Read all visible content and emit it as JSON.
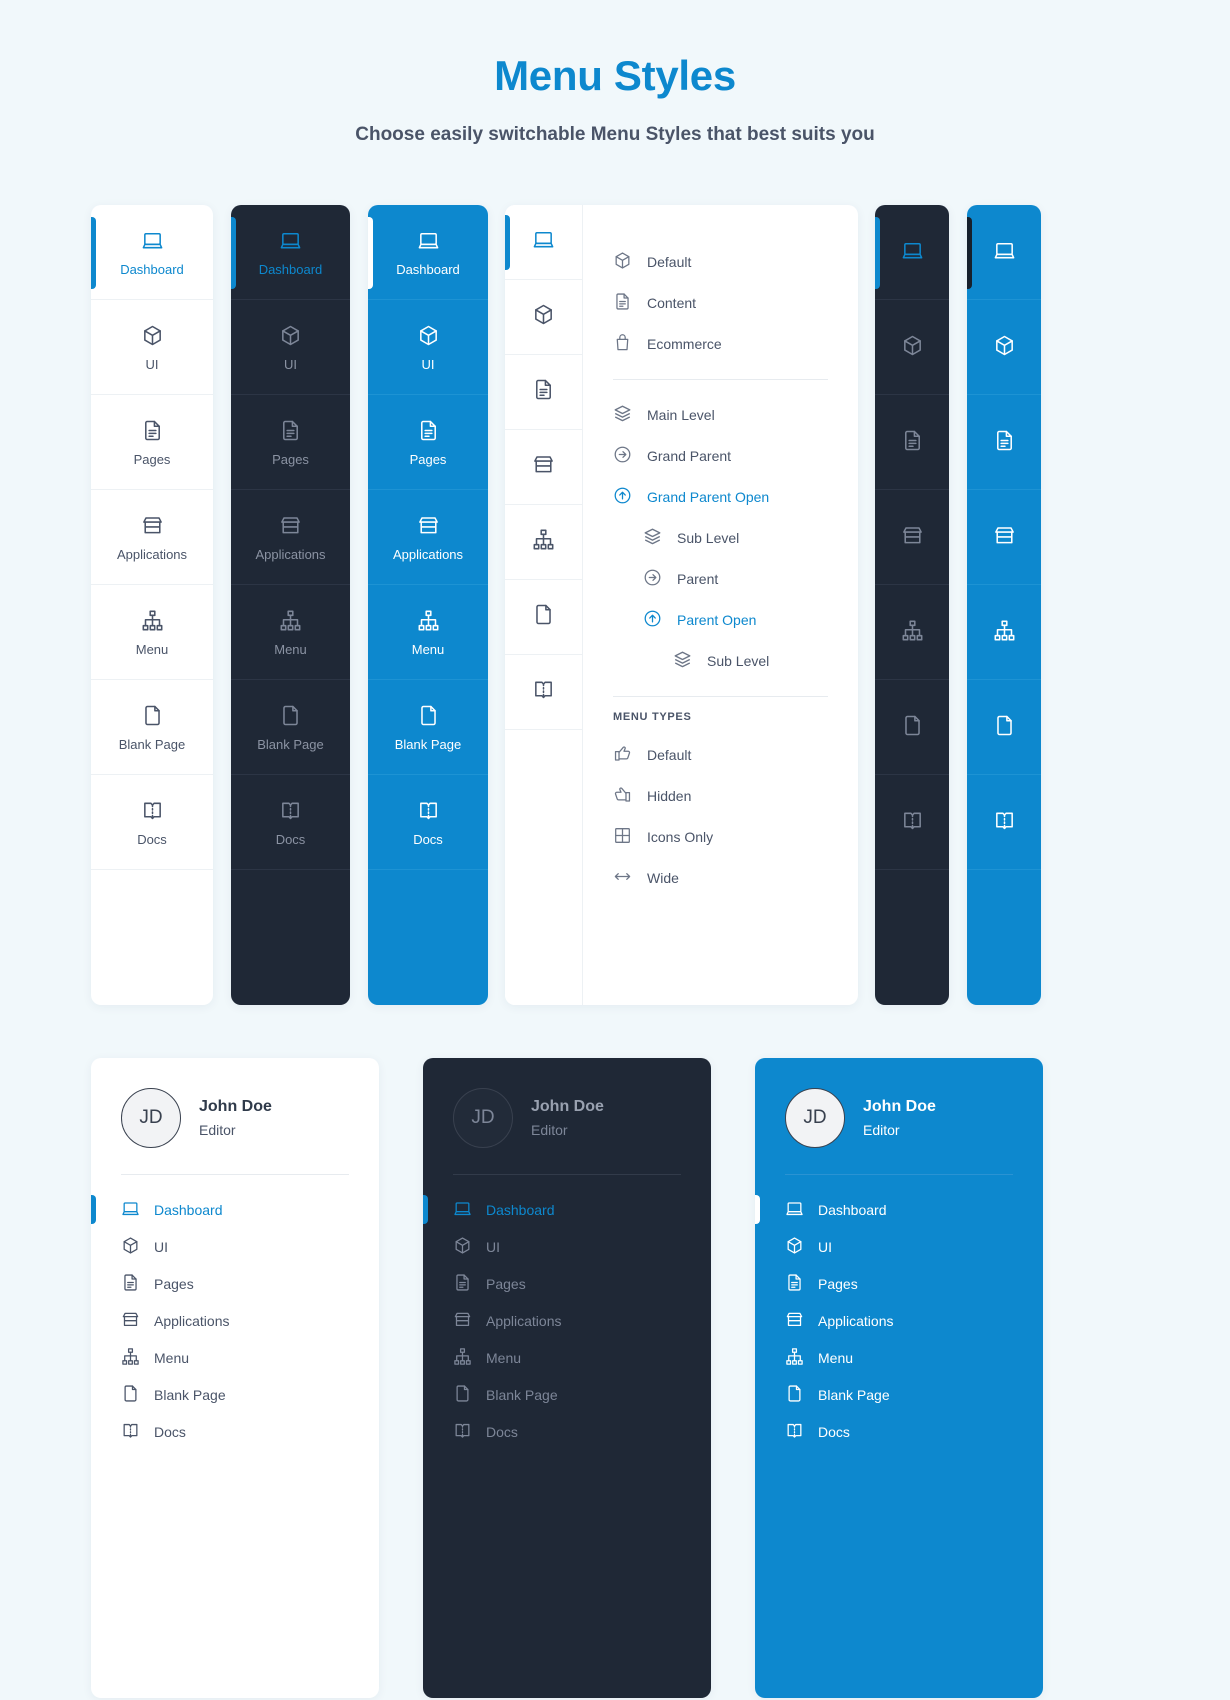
{
  "header": {
    "title": "Menu Styles",
    "subtitle": "Choose easily switchable Menu Styles that best suits you"
  },
  "colors": {
    "accent": "#0d88ce",
    "dark": "#1f2836",
    "page_bg": "#f1f8fb",
    "text": "#4a5468"
  },
  "main_menu": [
    {
      "label": "Dashboard",
      "icon": "laptop-icon"
    },
    {
      "label": "UI",
      "icon": "cube-icon"
    },
    {
      "label": "Pages",
      "icon": "document-lines-icon"
    },
    {
      "label": "Applications",
      "icon": "storefront-icon"
    },
    {
      "label": "Menu",
      "icon": "sitemap-icon"
    },
    {
      "label": "Blank Page",
      "icon": "blank-page-icon"
    },
    {
      "label": "Docs",
      "icon": "book-icon"
    }
  ],
  "panels": [
    {
      "name": "light-vertical-menu",
      "theme": "light",
      "active_index": 0
    },
    {
      "name": "dark-vertical-menu",
      "theme": "dark",
      "active_index": 0
    },
    {
      "name": "blue-vertical-menu",
      "theme": "blue",
      "active_index": 0
    },
    {
      "name": "light-submenu-panel",
      "theme": "light",
      "active_index": 0
    },
    {
      "name": "dark-icons-only-menu",
      "theme": "dark",
      "active_index": 0
    },
    {
      "name": "blue-icons-only-menu",
      "theme": "blue",
      "active_index": 0
    }
  ],
  "submenu": {
    "group_one": [
      {
        "label": "Default",
        "icon": "cube-icon",
        "level": 0,
        "accent": false
      },
      {
        "label": "Content",
        "icon": "document-lines-icon",
        "level": 0,
        "accent": false
      },
      {
        "label": "Ecommerce",
        "icon": "shopping-bag-icon",
        "level": 0,
        "accent": false
      }
    ],
    "group_two": [
      {
        "label": "Main Level",
        "icon": "layers-icon",
        "level": 0,
        "accent": false
      },
      {
        "label": "Grand Parent",
        "icon": "arrow-right-circle-icon",
        "level": 0,
        "accent": false
      },
      {
        "label": "Grand Parent Open",
        "icon": "arrow-up-circle-icon",
        "level": 0,
        "accent": true
      },
      {
        "label": "Sub Level",
        "icon": "layers-icon",
        "level": 1,
        "accent": false
      },
      {
        "label": "Parent",
        "icon": "arrow-right-circle-icon",
        "level": 1,
        "accent": false
      },
      {
        "label": "Parent Open",
        "icon": "arrow-up-circle-icon",
        "level": 1,
        "accent": true
      },
      {
        "label": "Sub Level",
        "icon": "layers-icon",
        "level": 2,
        "accent": false
      }
    ],
    "types_heading": "MENU TYPES",
    "group_three": [
      {
        "label": "Default",
        "icon": "thumb-right-icon",
        "level": 0,
        "accent": false
      },
      {
        "label": "Hidden",
        "icon": "thumb-left-icon",
        "level": 0,
        "accent": false
      },
      {
        "label": "Icons Only",
        "icon": "grid-icon",
        "level": 0,
        "accent": false
      },
      {
        "label": "Wide",
        "icon": "arrows-horizontal-icon",
        "level": 0,
        "accent": false
      }
    ]
  },
  "profile": {
    "initials": "JD",
    "name": "John Doe",
    "role": "Editor"
  },
  "profile_cards": [
    {
      "name": "light-profile-menu",
      "theme": "light",
      "active_index": 0
    },
    {
      "name": "dark-profile-menu",
      "theme": "dark",
      "active_index": 0
    },
    {
      "name": "blue-profile-menu",
      "theme": "blue",
      "active_index": 0
    }
  ]
}
